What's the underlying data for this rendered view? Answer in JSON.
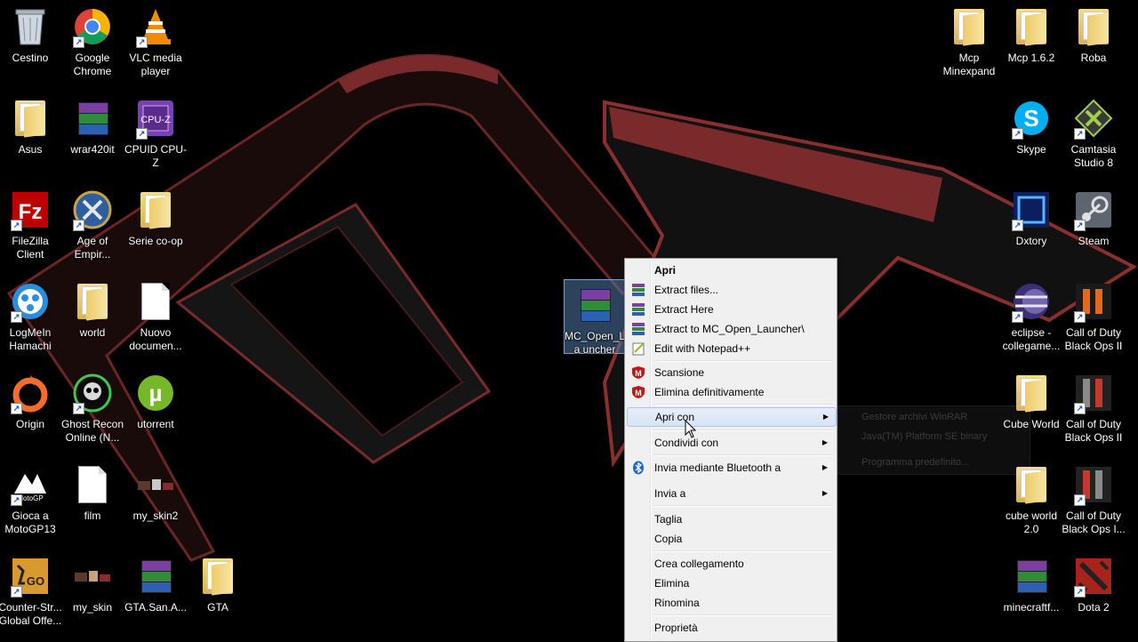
{
  "desktop": {
    "left_icons": [
      {
        "label": "Cestino",
        "icon": "recycle-bin-icon"
      },
      {
        "label": "Google Chrome",
        "icon": "chrome-icon"
      },
      {
        "label": "VLC media player",
        "icon": "vlc-icon"
      },
      {
        "label": "Asus",
        "icon": "folder-icon"
      },
      {
        "label": "wrar420it",
        "icon": "winrar-installer-icon"
      },
      {
        "label": "CPUID CPU-Z",
        "icon": "cpuz-icon"
      },
      {
        "label": "FileZilla Client",
        "icon": "filezilla-icon"
      },
      {
        "label": "Age of Empir...",
        "icon": "age-of-empires-icon"
      },
      {
        "label": "Serie co-op",
        "icon": "folder-icon"
      },
      {
        "label": "LogMeIn Hamachi",
        "icon": "hamachi-icon"
      },
      {
        "label": "world",
        "icon": "folder-icon"
      },
      {
        "label": "Nuovo documen...",
        "icon": "text-document-icon"
      },
      {
        "label": "Origin",
        "icon": "origin-icon"
      },
      {
        "label": "Ghost Recon Online (N...",
        "icon": "ghost-recon-icon"
      },
      {
        "label": "utorrent",
        "icon": "utorrent-icon"
      },
      {
        "label": "Gioca a MotoGP13",
        "icon": "motogp-icon"
      },
      {
        "label": "film",
        "icon": "document-icon"
      },
      {
        "label": "my_skin2",
        "icon": "skin-image-icon"
      },
      {
        "label": "Counter-Str... Global Offe...",
        "icon": "csgo-icon"
      },
      {
        "label": "my_skin",
        "icon": "skin-image-icon"
      },
      {
        "label": "GTA.San.A...",
        "icon": "winrar-archive-icon"
      },
      {
        "label": "GTA",
        "icon": "folder-icon"
      }
    ],
    "right_icons": [
      {
        "label": "Mcp Minexpand",
        "icon": "folder-icon"
      },
      {
        "label": "Mcp 1.6.2",
        "icon": "folder-icon"
      },
      {
        "label": "Roba",
        "icon": "folder-icon"
      },
      {
        "label": "Skype",
        "icon": "skype-icon"
      },
      {
        "label": "Camtasia Studio 8",
        "icon": "camtasia-icon"
      },
      {
        "label": "Dxtory",
        "icon": "dxtory-icon"
      },
      {
        "label": "Steam",
        "icon": "steam-icon"
      },
      {
        "label": "eclipse - collegame...",
        "icon": "eclipse-icon"
      },
      {
        "label": "Call of Duty Black Ops II",
        "icon": "black-ops-2-icon"
      },
      {
        "label": "Cube World",
        "icon": "folder-icon"
      },
      {
        "label": "Call of Duty Black Ops II",
        "icon": "black-ops-icon"
      },
      {
        "label": "cube world 2.0",
        "icon": "folder-icon"
      },
      {
        "label": "Call of Duty Black Ops I...",
        "icon": "black-ops-icon"
      },
      {
        "label": "minecraftf...",
        "icon": "winrar-archive-icon"
      },
      {
        "label": "Dota 2",
        "icon": "dota2-icon"
      }
    ],
    "selected_file": {
      "label": "MC_Open_La uncher",
      "icon": "winrar-archive-icon"
    }
  },
  "context_menu": {
    "items": [
      {
        "label": "Apri",
        "bold": true
      },
      {
        "label": "Extract files...",
        "icon": "winrar-icon"
      },
      {
        "label": "Extract Here",
        "icon": "winrar-icon"
      },
      {
        "label": "Extract to MC_Open_Launcher\\",
        "icon": "winrar-icon"
      },
      {
        "label": "Edit with Notepad++",
        "icon": "notepadpp-icon"
      },
      {
        "label": "Scansione",
        "icon": "mcafee-icon"
      },
      {
        "label": "Elimina definitivamente",
        "icon": "mcafee-icon"
      },
      {
        "label": "Apri con",
        "submenu": true,
        "highlighted": true
      },
      {
        "label": "Condividi con",
        "submenu": true
      },
      {
        "label": "Invia mediante Bluetooth a",
        "submenu": true,
        "icon": "bluetooth-icon"
      },
      {
        "label": "Invia a",
        "submenu": true
      },
      {
        "label": "Taglia"
      },
      {
        "label": "Copia"
      },
      {
        "label": "Crea collegamento"
      },
      {
        "label": "Elimina"
      },
      {
        "label": "Rinomina"
      },
      {
        "label": "Proprietà"
      }
    ]
  },
  "submenu": {
    "items": [
      "Gestore archivi WinRAR",
      "Java(TM) Platform SE binary",
      "Programma predefinito..."
    ]
  },
  "colors": {
    "menu_bg": "#f0f0f0",
    "highlight": "#d4e4f7",
    "wallpaper": "#000000",
    "logo_red": "#8a2e2e"
  }
}
